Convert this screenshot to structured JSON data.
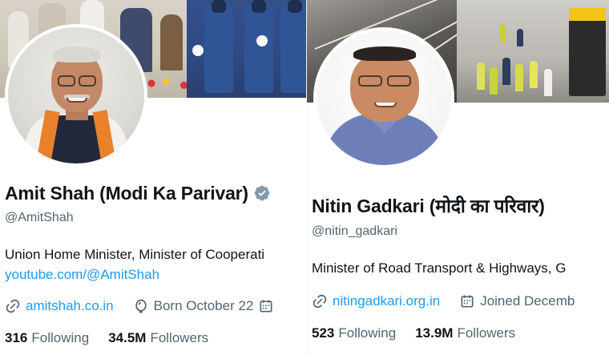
{
  "profiles": [
    {
      "name": "Amit Shah (Modi Ka Parivar)",
      "verified": true,
      "handle": "@AmitShah",
      "bio": "Union Home Minister, Minister of Cooperati",
      "bio_link": "youtube.com/@AmitShah",
      "website": "amitshah.co.in",
      "born": "Born October 22",
      "following_count": "316",
      "following_label": "Following",
      "followers_count": "34.5M",
      "followers_label": "Followers",
      "icons": {
        "link": "link-icon",
        "location": "balloon-icon",
        "calendar": "calendar-icon"
      }
    },
    {
      "name": "Nitin Gadkari (मोदी का परिवार)",
      "handle": "@nitin_gadkari",
      "bio": "Minister of Road Transport & Highways, G",
      "website": "nitingadkari.org.in",
      "joined": "Joined Decemb",
      "following_count": "523",
      "following_label": "Following",
      "followers_count": "13.9M",
      "followers_label": "Followers",
      "icons": {
        "link": "link-icon",
        "calendar": "calendar-icon"
      }
    }
  ],
  "colors": {
    "accent": "#1d9bf0",
    "secondary_text": "#536471",
    "primary_text": "#0f1419",
    "verified": "#829aab"
  }
}
